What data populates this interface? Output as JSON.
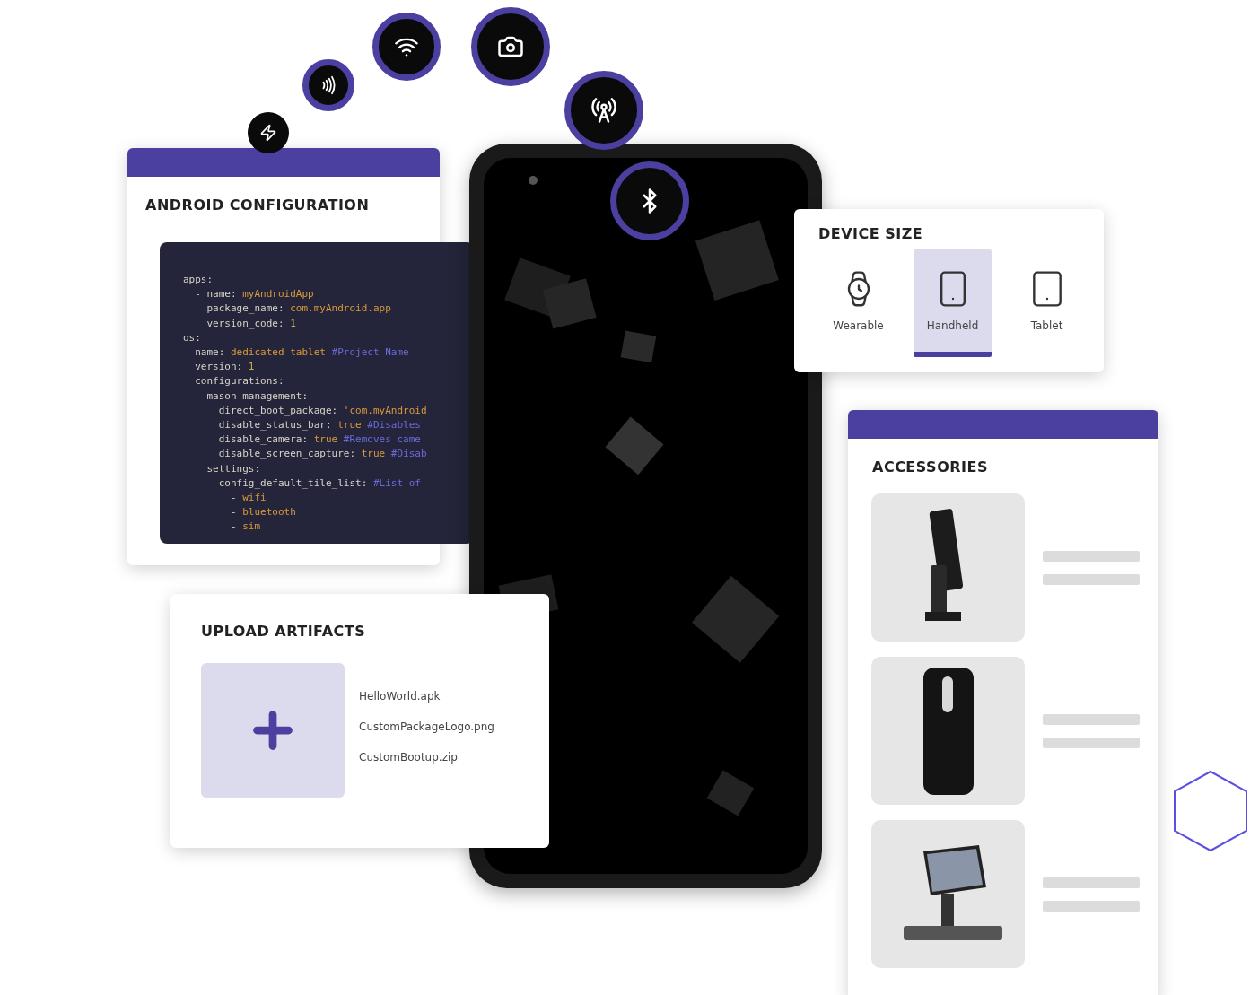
{
  "android_configuration": {
    "title": "ANDROID CONFIGURATION",
    "code_lines": [
      [
        {
          "kind": "key",
          "text": "apps:"
        }
      ],
      [
        {
          "kind": "key",
          "text": "  - name: "
        },
        {
          "kind": "value",
          "text": "myAndroidApp"
        }
      ],
      [
        {
          "kind": "key",
          "text": "    package_name: "
        },
        {
          "kind": "value",
          "text": "com.myAndroid.app"
        }
      ],
      [
        {
          "kind": "key",
          "text": "    version_code: "
        },
        {
          "kind": "number",
          "text": "1"
        }
      ],
      [
        {
          "kind": "key",
          "text": "os:"
        }
      ],
      [
        {
          "kind": "key",
          "text": "  name: "
        },
        {
          "kind": "value",
          "text": "dedicated-tablet "
        },
        {
          "kind": "comment",
          "text": "#Project Name"
        }
      ],
      [
        {
          "kind": "key",
          "text": "  version: "
        },
        {
          "kind": "number",
          "text": "1"
        }
      ],
      [
        {
          "kind": "key",
          "text": "  configurations:"
        }
      ],
      [
        {
          "kind": "key",
          "text": "    mason-management:"
        }
      ],
      [
        {
          "kind": "key",
          "text": "      direct_boot_package: "
        },
        {
          "kind": "value",
          "text": "'com.myAndroid"
        }
      ],
      [
        {
          "kind": "key",
          "text": "      disable_status_bar: "
        },
        {
          "kind": "value",
          "text": "true "
        },
        {
          "kind": "comment",
          "text": "#Disables"
        }
      ],
      [
        {
          "kind": "key",
          "text": "      disable_camera: "
        },
        {
          "kind": "value",
          "text": "true "
        },
        {
          "kind": "comment",
          "text": "#Removes came"
        }
      ],
      [
        {
          "kind": "key",
          "text": "      disable_screen_capture: "
        },
        {
          "kind": "value",
          "text": "true "
        },
        {
          "kind": "comment",
          "text": "#Disab"
        }
      ],
      [
        {
          "kind": "key",
          "text": "    settings:"
        }
      ],
      [
        {
          "kind": "key",
          "text": "      config_default_tile_list: "
        },
        {
          "kind": "comment",
          "text": "#List of"
        }
      ],
      [
        {
          "kind": "key",
          "text": "        - "
        },
        {
          "kind": "value",
          "text": "wifi"
        }
      ],
      [
        {
          "kind": "key",
          "text": "        - "
        },
        {
          "kind": "value",
          "text": "bluetooth"
        }
      ],
      [
        {
          "kind": "key",
          "text": "        - "
        },
        {
          "kind": "value",
          "text": "sim"
        }
      ]
    ]
  },
  "device_size": {
    "title": "DEVICE SIZE",
    "options": [
      {
        "kind": "wearable",
        "label": "Wearable",
        "selected": false
      },
      {
        "kind": "handheld",
        "label": "Handheld",
        "selected": true
      },
      {
        "kind": "tablet",
        "label": "Tablet",
        "selected": false
      }
    ]
  },
  "accessories": {
    "title": "ACCESSORIES"
  },
  "upload_artifacts": {
    "title": "UPLOAD ARTIFACTS",
    "files": [
      "HelloWorld.apk",
      "CustomPackageLogo.png",
      "CustomBootup.zip"
    ]
  },
  "feature_icons": [
    {
      "kind": "flash"
    },
    {
      "kind": "nfc"
    },
    {
      "kind": "wifi"
    },
    {
      "kind": "camera"
    },
    {
      "kind": "tower"
    },
    {
      "kind": "bluetooth"
    }
  ]
}
